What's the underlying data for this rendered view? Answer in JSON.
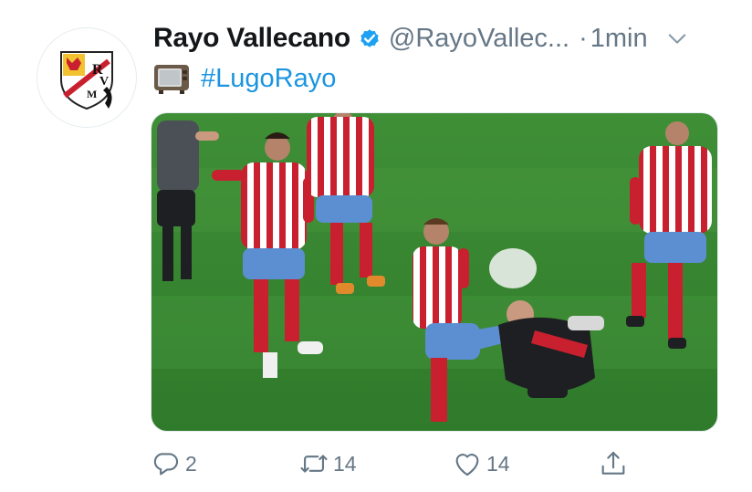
{
  "tweet": {
    "display_name": "Rayo Vallecano",
    "handle": "@RayoVallec...",
    "separator": "·",
    "time": "1min",
    "hashtag": "#LugoRayo"
  },
  "avatar": {
    "logo_letters": "RVM"
  },
  "actions": {
    "reply_count": "2",
    "retweet_count": "14",
    "like_count": "14"
  },
  "icons": {
    "verified": "verified-badge-icon",
    "more": "chevron-down-icon",
    "tv": "television-emoji-icon",
    "reply": "reply-icon",
    "retweet": "retweet-icon",
    "like": "heart-icon",
    "share": "share-icon"
  },
  "colors": {
    "link": "#1b95e0",
    "verified": "#1da1f2",
    "muted": "#657786",
    "pitch": "#3c8a35",
    "lugo_red": "#c8202f"
  }
}
